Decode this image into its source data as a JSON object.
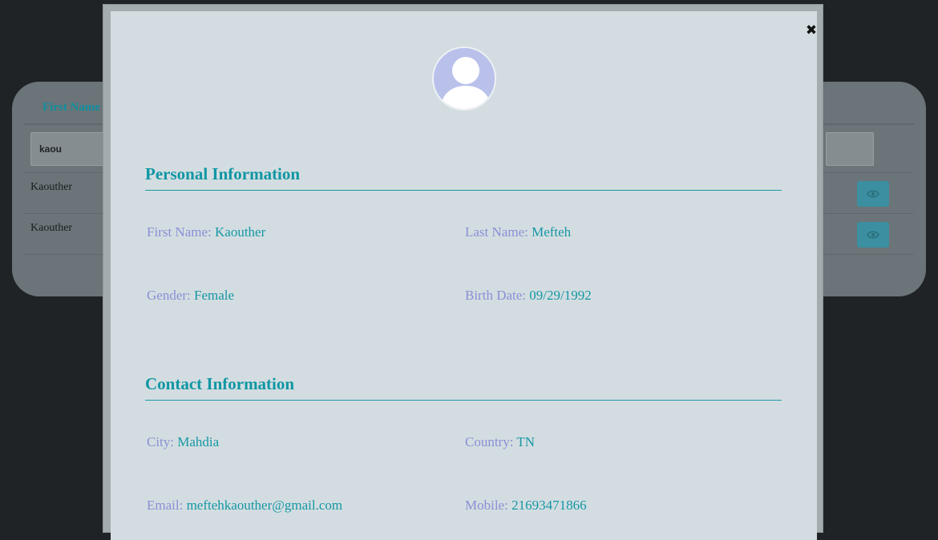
{
  "background_table": {
    "column_header": "First Name",
    "filter_value": "kaou",
    "rows": [
      "Kaouther",
      "Kaouther"
    ]
  },
  "modal": {
    "personal_section_title": "Personal Information",
    "first_name_label": "First Name:",
    "first_name_value": "Kaouther",
    "last_name_label": "Last Name:",
    "last_name_value": "Mefteh",
    "gender_label": "Gender:",
    "gender_value": "Female",
    "birth_date_label": "Birth Date:",
    "birth_date_value": "09/29/1992",
    "contact_section_title": "Contact Information",
    "city_label": "City:",
    "city_value": "Mahdia",
    "country_label": "Country:",
    "country_value": "TN",
    "email_label": "Email:",
    "email_value": "meftehkaouther@gmail.com",
    "mobile_label": "Mobile:",
    "mobile_value": "21693471866",
    "close_icon": "close-icon",
    "avatar_icon": "user-avatar-icon"
  },
  "colors": {
    "accent": "#0f96a3",
    "label": "#8a8fd6",
    "modal_bg": "#d3dde1",
    "overlay_bg": "#1f2326"
  }
}
